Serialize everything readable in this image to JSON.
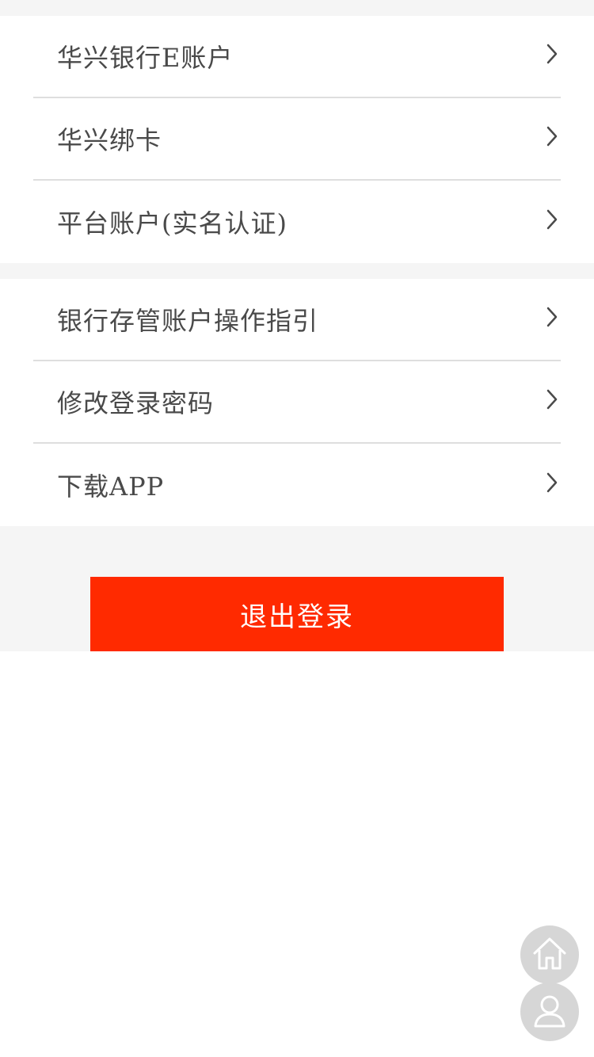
{
  "groups": [
    {
      "items": [
        {
          "label": "华兴银行E账户",
          "icon": "chevron-right-icon"
        },
        {
          "label": "华兴绑卡",
          "icon": "chevron-right-icon"
        },
        {
          "label": "平台账户(实名认证)",
          "icon": "chevron-right-icon"
        }
      ]
    },
    {
      "items": [
        {
          "label": "银行存管账户操作指引",
          "icon": "chevron-right-icon"
        },
        {
          "label": "修改登录密码",
          "icon": "chevron-right-icon"
        },
        {
          "label": "下载APP",
          "icon": "chevron-right-icon"
        }
      ]
    }
  ],
  "logout": {
    "label": "退出登录",
    "color": "#ff2a00"
  },
  "floating": {
    "home_icon": "home-icon",
    "user_icon": "user-icon",
    "color": "#d6d6d6"
  },
  "colors": {
    "background_gray": "#f5f5f5",
    "text": "#4a4a4a",
    "divider": "#dedede"
  }
}
